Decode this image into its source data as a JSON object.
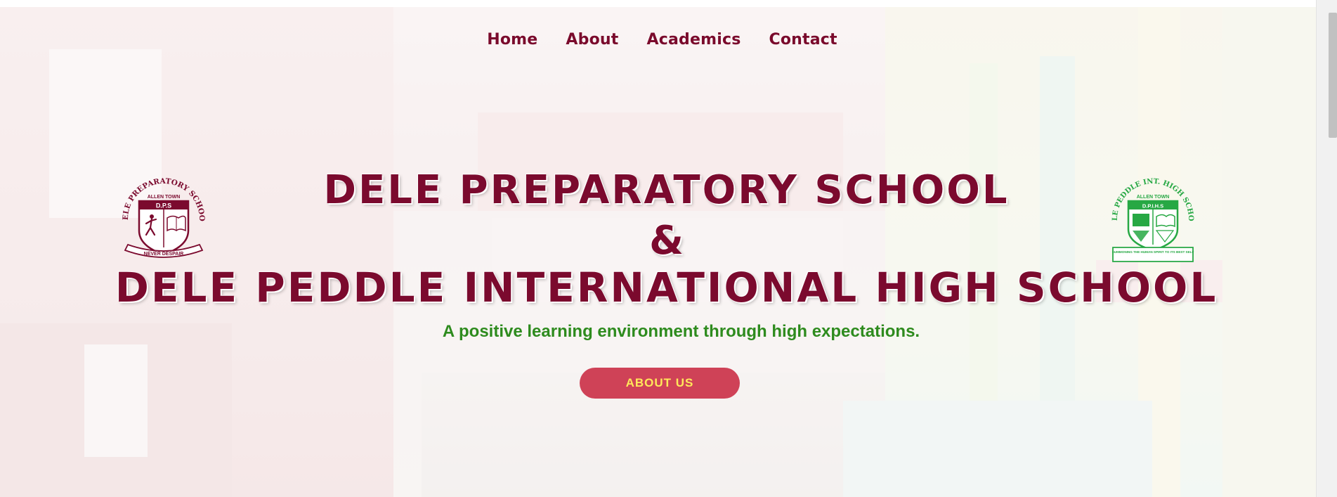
{
  "nav": {
    "items": [
      {
        "label": "Home"
      },
      {
        "label": "About"
      },
      {
        "label": "Academics"
      },
      {
        "label": "Contact"
      }
    ]
  },
  "hero": {
    "title_line1": "DELE PREPARATORY SCHOOL",
    "ampersand": "&",
    "title_line2": "DELE PEDDLE INTERNATIONAL HIGH SCHOOL",
    "tagline": "A positive learning environment through high expectations.",
    "cta_label": "ABOUT US"
  },
  "crest_left": {
    "arc_text": "DELE PREPARATORY SCHOOL",
    "town": "ALLEN TOWN",
    "initials": "D.P.S",
    "motto": "NEVER DESPAIR"
  },
  "crest_right": {
    "arc_text": "DELE PEDDLE INT. HIGH SCHOOL",
    "town": "ALLEN TOWN",
    "initials": "D.P.I.H.S",
    "motto": "SUMMONING THE HUMAN SPIRIT TO ITS BEST SELF"
  },
  "colors": {
    "brand_maroon": "#7b0a2e",
    "tagline_green": "#2e8b1e",
    "cta_background": "#cf4257",
    "cta_text": "#ffe85a",
    "crest_right_green": "#27a844"
  }
}
